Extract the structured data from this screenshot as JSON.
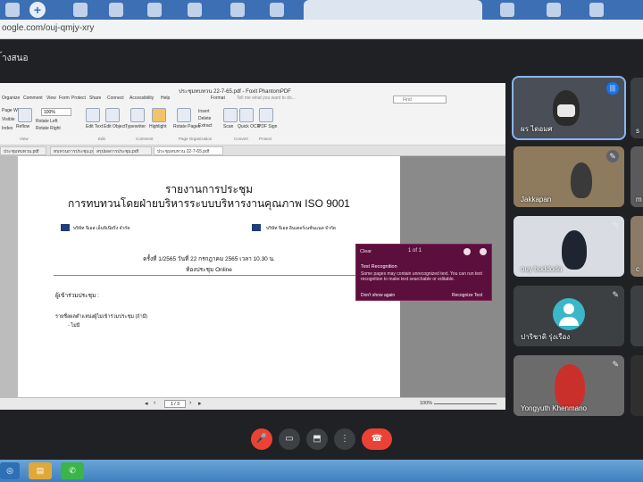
{
  "browser": {
    "url": "oogle.com/ouj-qmjy-xry"
  },
  "meet": {
    "header_title": "้างสนอ"
  },
  "pdf_app": {
    "title": "ประชุมทบทวน 22-7-65.pdf - Foxit PhantomPDF",
    "menus": [
      "Organize",
      "Comment",
      "View",
      "Form",
      "Protect",
      "Share",
      "Connect",
      "Accessibility",
      "Help",
      "Format"
    ],
    "search_placeholder": "Find",
    "ribbon_tell": "Tell me what you want to do...",
    "zoom_value": "100%",
    "ribbon_labels": {
      "page_width": "Page Width",
      "visible": "Visible",
      "rotate_left": "Rotate Left",
      "rotate_right": "Rotate Right",
      "edit_text": "Edit Text",
      "edit_object": "Edit Object",
      "typewriter": "Typewriter",
      "highlight": "Highlight",
      "rotate_pages": "Rotate Pages",
      "insert": "Insert",
      "delete": "Delete",
      "extract": "Extract",
      "scan": "Scan",
      "quick_ocr": "Quick OCR",
      "pdf_sign": "PDF Sign",
      "fit_page": "Page",
      "reflow": "Reflow",
      "index": "Index"
    },
    "ribbon_groups": [
      "View",
      "Edit",
      "Comment",
      "Page Organization",
      "Convert",
      "Protect"
    ],
    "doc_tabs": [
      "ประชุมทบทวน.pdf",
      "ทบทวนการประชุม.pdf",
      "สรุปผลการประชุม.pdf",
      "ประชุมทบทวน 22-7-65.pdf"
    ],
    "document": {
      "title_line1": "รายงานการประชุม",
      "title_line2": "การทบทวนโดยฝ่ายบริหารระบบบริหารงานคุณภาพ ISO 9001",
      "company_left": "บริษัท จีเอส เอ็นจิเนียริ่ง จำกัด",
      "company_right": "บริษัท จีเอส อินเตอร์เนชั่นแนล จำกัด",
      "meeting_no": "ครั้งที่ 1/2565 วันที่ 22 กรกฎาคม 2565 เวลา 10.30 น.",
      "meeting_room": "ห้องประชุม Online",
      "attendees_label": "ผู้เข้าร่วมประชุม :",
      "absent_line": "รายชื่อผลตำแหน่งผู้ไม่เข้าร่วมประชุม (ถ้ามี)",
      "absent_value": "- ไม่มี"
    },
    "popup": {
      "title": "Clear",
      "nav": "1 of 1",
      "heading": "Text Recognition",
      "body": "Some pages may contain unrecognized text. You can run text recognition to make text searchable or editable.",
      "checkbox_label": "Don't show again",
      "link": "Recognize Text"
    },
    "status": {
      "page": "1 / 3",
      "zoom": "100%"
    }
  },
  "participants": [
    {
      "name": "ผร ไดอมศ",
      "speaking": true
    },
    {
      "name": "Jakkapan",
      "speaking": false
    },
    {
      "name": "ouy buddoda",
      "speaking": false
    },
    {
      "name": "ปาริชาติ รุ่งเรือง",
      "speaking": false
    },
    {
      "name": "Yongyuth Khenmano",
      "speaking": false
    }
  ],
  "right_partial_initials": [
    "s",
    "m",
    "c"
  ],
  "controls": {
    "mic": "🎤",
    "camera": "▭",
    "present": "⬒",
    "more": "⋮",
    "end": "☎"
  },
  "colors": {
    "meet_bg": "#202124",
    "end_call": "#ea4335",
    "popup_bg": "#5c0f3d",
    "active_tile": "#8ab4f8"
  }
}
